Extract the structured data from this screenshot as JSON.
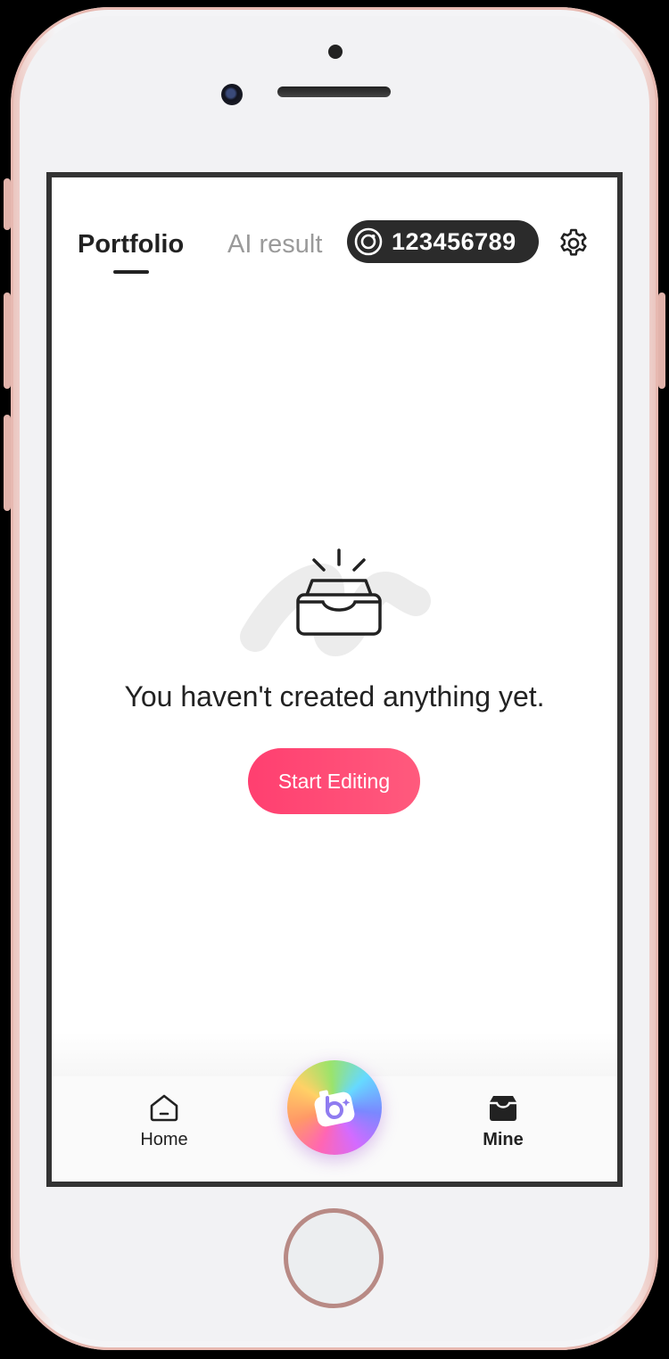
{
  "header": {
    "tabs": [
      {
        "label": "Portfolio",
        "active": true
      },
      {
        "label": "AI result",
        "active": false
      }
    ],
    "coin_balance": "123456789",
    "coin_icon": "coin-icon",
    "settings_icon": "gear-icon"
  },
  "empty_state": {
    "icon": "empty-inbox-icon",
    "message": "You haven't created anything yet.",
    "cta_label": "Start Editing"
  },
  "bottom_nav": {
    "items": [
      {
        "label": "Home",
        "icon": "home-icon"
      },
      {
        "label": "Mine",
        "icon": "mine-box-icon"
      }
    ],
    "center_button_icon": "camera-icon"
  },
  "colors": {
    "accent": "#ff4a72",
    "text_primary": "#222222",
    "text_inactive": "#9a9a9a",
    "badge_bg": "#2b2b2b"
  }
}
